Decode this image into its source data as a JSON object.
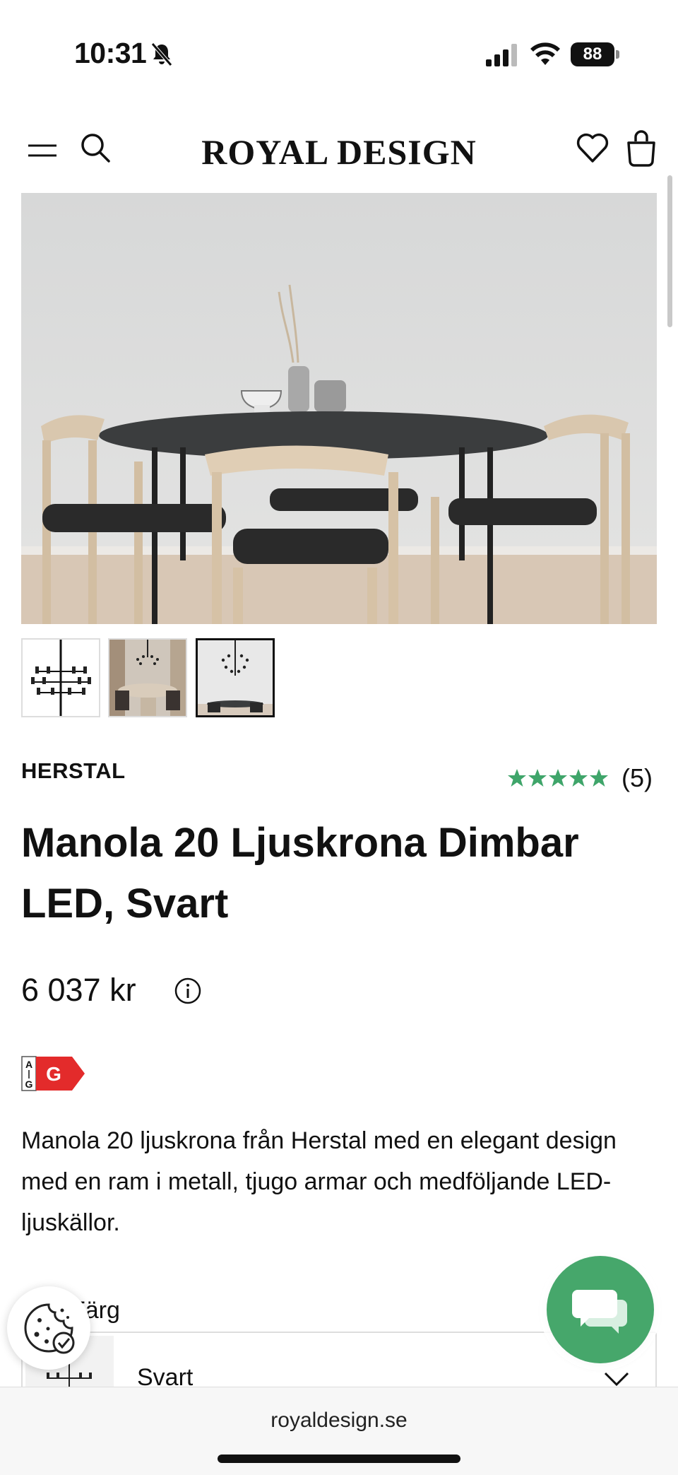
{
  "status_bar": {
    "time": "10:31",
    "battery": "88"
  },
  "header": {
    "logo": "ROYAL DESIGN"
  },
  "product": {
    "brand": "HERSTAL",
    "rating": {
      "value_out_of_5": 5,
      "review_count": "(5)"
    },
    "title": "Manola 20 Ljuskrona Dimbar LED, Svart",
    "price": "6 037 kr",
    "energy_label": {
      "scale_top": "A",
      "scale_bottom": "G",
      "class": "G",
      "color": "#e32b2b"
    },
    "description": "Manola 20 ljuskrona från Herstal med en elegant design med en ram i metall, tjugo armar och medföljande LED-ljuskällor.",
    "color_selector": {
      "label": "Färg",
      "value": "Svart"
    }
  },
  "colors": {
    "accent_green": "#46a76b",
    "star_green": "#3fa56a"
  },
  "browser": {
    "url": "royaldesign.se"
  }
}
